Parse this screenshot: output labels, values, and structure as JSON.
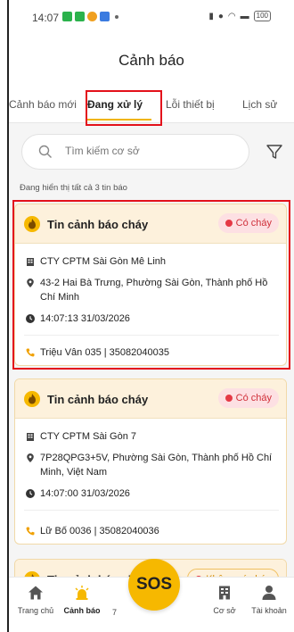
{
  "status_bar": {
    "time": "14:07",
    "battery": "100"
  },
  "header": {
    "title": "Cảnh báo"
  },
  "tabs": [
    {
      "label": "Cảnh báo mới"
    },
    {
      "label": "Đang xử lý"
    },
    {
      "label": "Lỗi thiết bị"
    },
    {
      "label": "Lịch sử"
    }
  ],
  "search": {
    "placeholder": "Tìm kiếm cơ sở"
  },
  "info_text": "Đang hiển thị tất cả 3 tin báo",
  "alerts": [
    {
      "title": "Tin cảnh báo cháy",
      "badge": "Có cháy",
      "company": "CTY CPTM Sài Gòn Mê Linh",
      "address": "43-2 Hai Bà Trưng, Phường Sài Gòn, Thành phố Hồ Chí Minh",
      "time": "14:07:13 31/03/2026",
      "contact": "Triệu Vân 035 | 35082040035"
    },
    {
      "title": "Tin cảnh báo cháy",
      "badge": "Có cháy",
      "company": "CTY CPTM Sài Gòn 7",
      "address": "7P28QPG3+5V, Phường Sài Gòn, Thành phố Hồ Chí Minh, Việt Nam",
      "time": "14:07:00 31/03/2026",
      "contact": "Lữ Bố 0036 | 35082040036"
    },
    {
      "title": "Tin cảnh báo ch",
      "badge": "Không có cháy"
    }
  ],
  "bottom_nav": {
    "items": [
      {
        "label": "Trang chủ"
      },
      {
        "label": "Cảnh báo"
      },
      {
        "label": "Cơ sở"
      },
      {
        "label": "Tài khoản"
      }
    ],
    "sos_label": "SOS",
    "partial_text": "7"
  },
  "colors": {
    "accent": "#f6b800",
    "danger": "#e53946",
    "highlight": "#e3111b"
  }
}
